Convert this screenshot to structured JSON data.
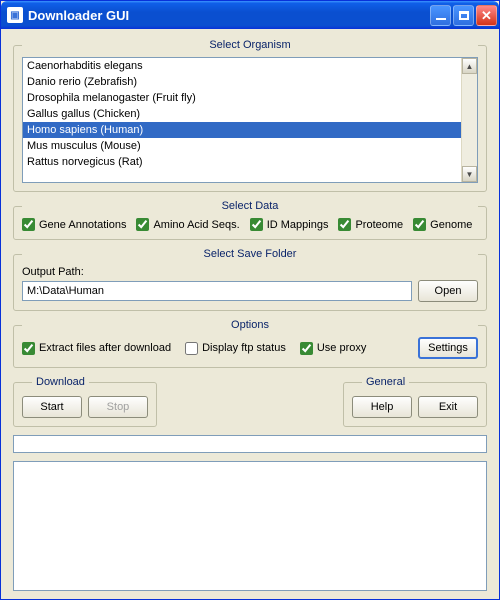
{
  "window": {
    "title": "Downloader GUI"
  },
  "organism": {
    "legend": "Select Organism",
    "items": [
      "Caenorhabditis elegans",
      "Danio rerio (Zebrafish)",
      "Drosophila melanogaster (Fruit fly)",
      "Gallus gallus (Chicken)",
      "Homo sapiens (Human)",
      "Mus musculus (Mouse)",
      "Rattus norvegicus (Rat)"
    ],
    "selected_index": 4
  },
  "data": {
    "legend": "Select Data",
    "checkboxes": {
      "gene_annotations": {
        "label": "Gene Annotations",
        "checked": true
      },
      "amino_acid_seqs": {
        "label": "Amino Acid Seqs.",
        "checked": true
      },
      "id_mappings": {
        "label": "ID Mappings",
        "checked": true
      },
      "proteome": {
        "label": "Proteome",
        "checked": true
      },
      "genome": {
        "label": "Genome",
        "checked": true
      }
    }
  },
  "save": {
    "legend": "Select Save Folder",
    "label": "Output Path:",
    "path": "M:\\Data\\Human",
    "open_button": "Open"
  },
  "options": {
    "legend": "Options",
    "extract": {
      "label": "Extract files after download",
      "checked": true
    },
    "ftpstatus": {
      "label": "Display ftp status",
      "checked": false
    },
    "proxy": {
      "label": "Use proxy",
      "checked": true
    },
    "settings_button": "Settings"
  },
  "download": {
    "legend": "Download",
    "start": "Start",
    "stop": "Stop"
  },
  "general": {
    "legend": "General",
    "help": "Help",
    "exit": "Exit"
  }
}
